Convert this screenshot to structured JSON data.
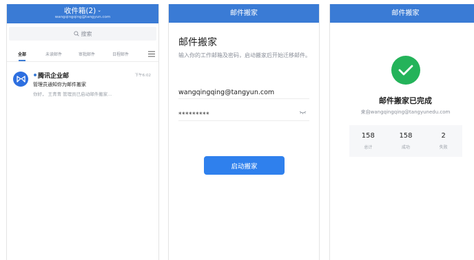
{
  "inbox": {
    "title": "收件箱(2)",
    "account": "wangqingqing@tangyun.com",
    "search_placeholder": "搜索",
    "tabs": [
      {
        "label": "全部",
        "active": true
      },
      {
        "label": "未读邮件",
        "active": false
      },
      {
        "label": "审批邮件",
        "active": false
      },
      {
        "label": "日程邮件",
        "active": false
      }
    ],
    "mail": {
      "sender": "腾讯企业邮",
      "time": "下午6:02",
      "subject": "管理员通知你为邮件搬家",
      "preview": "你好， 王青青 管理员已启动邮件搬家..."
    }
  },
  "migrate": {
    "bar_title": "邮件搬家",
    "heading": "邮件搬家",
    "description": "输入你的工作邮箱及密码，启动搬家后开始迁移邮件。",
    "email_value": "wangqingqing@tangyun.com",
    "password_value": "*********",
    "start_label": "启动搬家"
  },
  "done": {
    "bar_title": "邮件搬家",
    "title": "邮件搬家已完成",
    "source": "来自wangqingqing@tangyunedu.com",
    "stats": [
      {
        "value": "158",
        "label": "总计"
      },
      {
        "value": "158",
        "label": "成功"
      },
      {
        "value": "2",
        "label": "失败"
      }
    ]
  },
  "colors": {
    "brand_blue": "#3a7bd5",
    "button_blue": "#2f80ed",
    "success_green": "#24b35a"
  },
  "icons": [
    "search-icon",
    "menu-icon",
    "tencent-mail-logo-icon",
    "eye-closed-icon",
    "checkmark-icon"
  ]
}
